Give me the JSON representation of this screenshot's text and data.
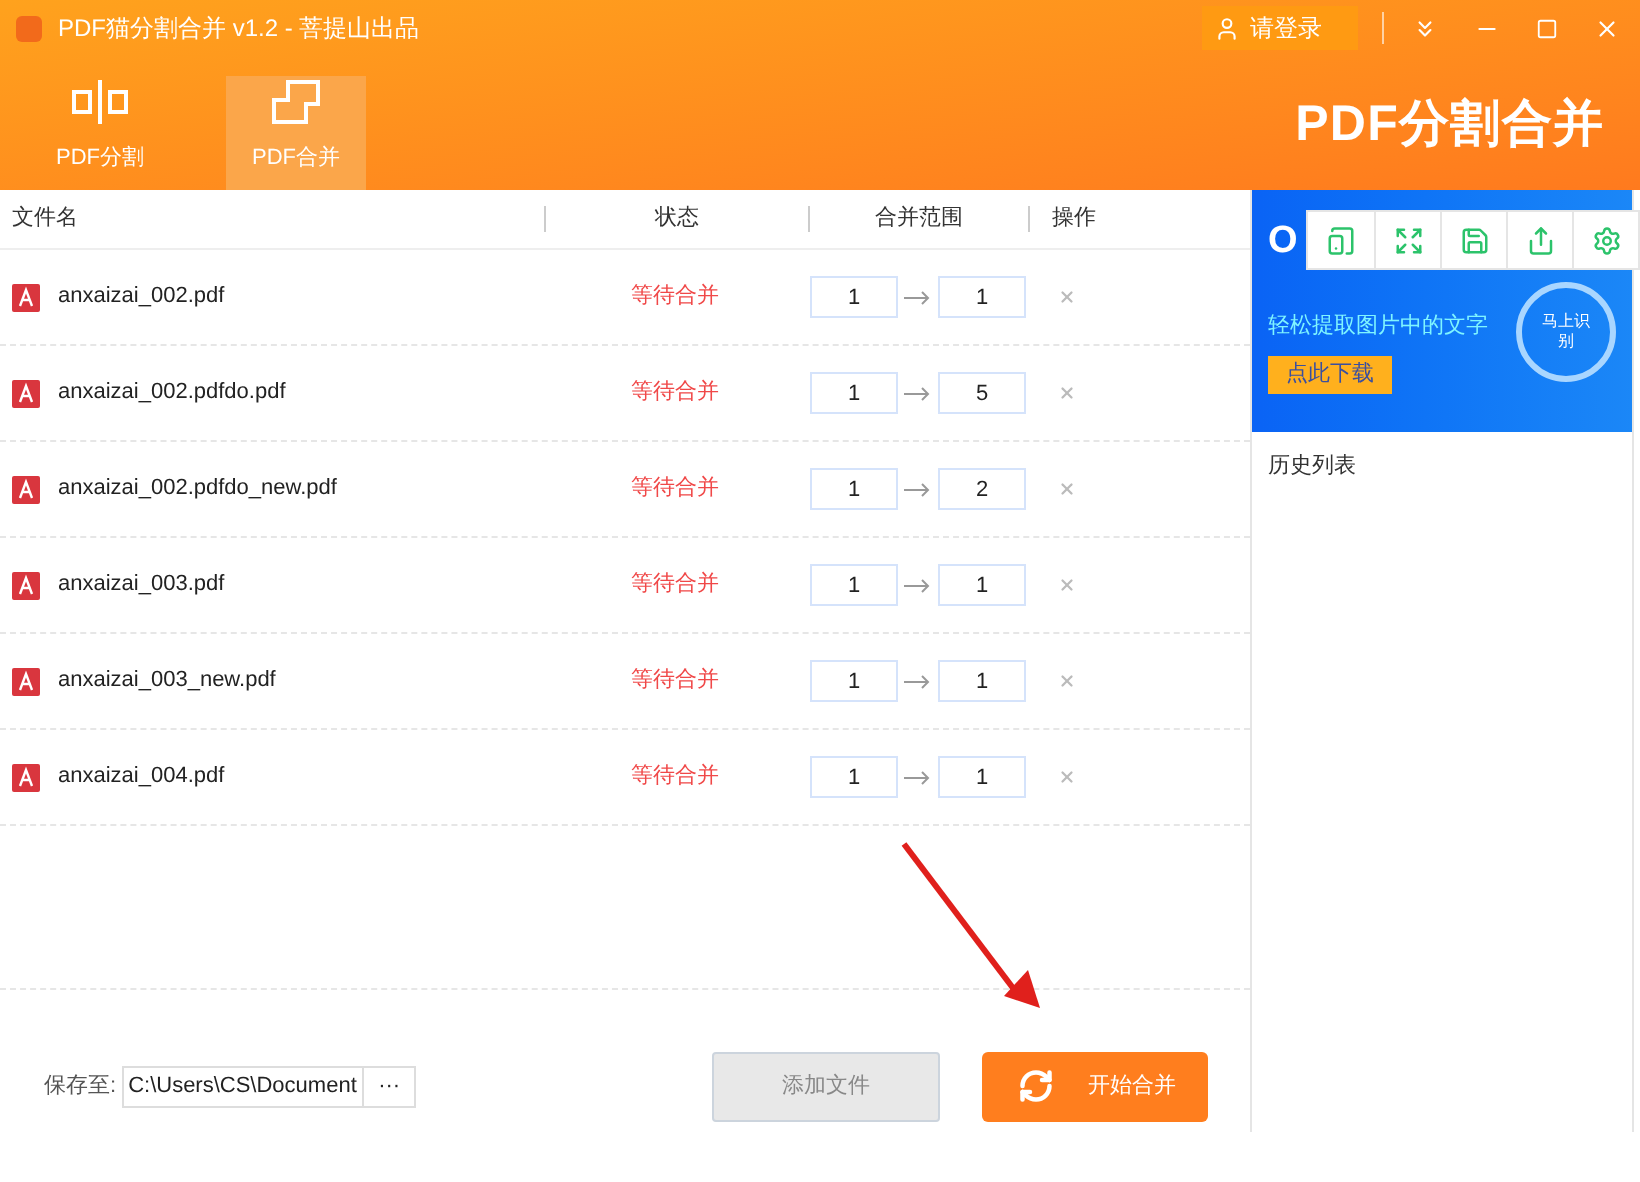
{
  "window": {
    "title": "PDF猫分割合并 v1.2 - 菩提山出品",
    "login": "请登录",
    "brand": "PDF分割合并"
  },
  "tabs": [
    {
      "label": "PDF分割",
      "selected": false,
      "kind": "split"
    },
    {
      "label": "PDF合并",
      "selected": true,
      "kind": "merge"
    }
  ],
  "table": {
    "columns": [
      "文件名",
      "状态",
      "合并范围",
      "操作"
    ],
    "rows": [
      {
        "name": "anxaizai_002.pdf",
        "status": "等待合并",
        "from": "1",
        "to": "1"
      },
      {
        "name": "anxaizai_002.pdfdo.pdf",
        "status": "等待合并",
        "from": "1",
        "to": "5"
      },
      {
        "name": "anxaizai_002.pdfdo_new.pdf",
        "status": "等待合并",
        "from": "1",
        "to": "2"
      },
      {
        "name": "anxaizai_003.pdf",
        "status": "等待合并",
        "from": "1",
        "to": "1"
      },
      {
        "name": "anxaizai_003_new.pdf",
        "status": "等待合并",
        "from": "1",
        "to": "1"
      },
      {
        "name": "anxaizai_004.pdf",
        "status": "等待合并",
        "from": "1",
        "to": "1"
      }
    ]
  },
  "footer": {
    "save_label": "保存至:",
    "save_path": "C:\\Users\\CS\\Document",
    "browse": "···",
    "add_button": "添加文件",
    "start_button": "开始合并"
  },
  "ad": {
    "heading": "O",
    "tagline": "轻松提取图片中的文字",
    "button": "点此下载",
    "badge": "马上识别"
  },
  "history": {
    "title": "历史列表"
  }
}
